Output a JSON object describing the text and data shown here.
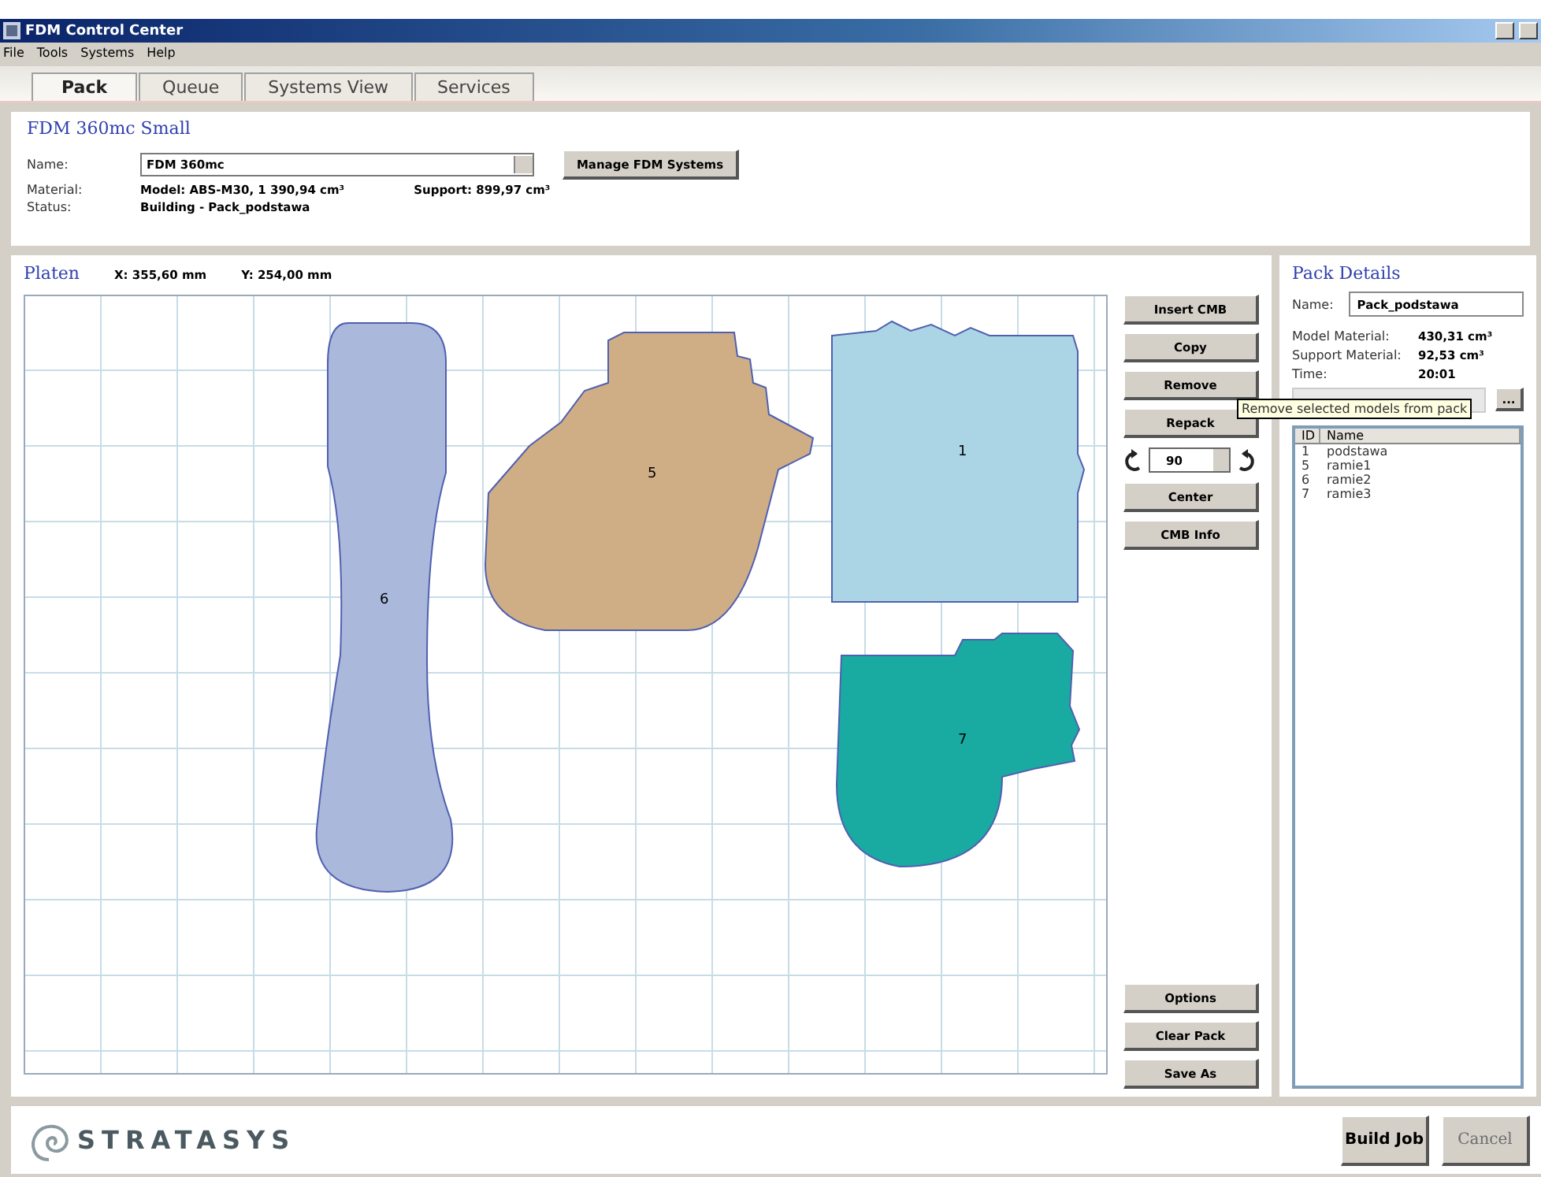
{
  "window": {
    "title": "FDM Control Center"
  },
  "menu": [
    "File",
    "Tools",
    "Systems",
    "Help"
  ],
  "tabs": [
    {
      "label": "Pack",
      "selected": true
    },
    {
      "label": "Queue",
      "selected": false
    },
    {
      "label": "Systems View",
      "selected": false
    },
    {
      "label": "Services",
      "selected": false
    }
  ],
  "system": {
    "title": "FDM 360mc Small",
    "name_label": "Name:",
    "name_value": "FDM 360mc",
    "manage_button": "Manage FDM Systems",
    "material_label": "Material:",
    "model_material": "Model: ABS-M30, 1 390,94 cm³",
    "support_material": "Support: 899,97 cm³",
    "status_label": "Status:",
    "status_value": "Building - Pack_podstawa"
  },
  "platen": {
    "title": "Platen",
    "x": "X: 355,60 mm",
    "y": "Y: 254,00 mm",
    "models": [
      {
        "label": "6",
        "color": "#aab8dc"
      },
      {
        "label": "5",
        "color": "#cfae86"
      },
      {
        "label": "1",
        "color": "#abd5e4"
      },
      {
        "label": "7",
        "color": "#19aba1"
      }
    ]
  },
  "actions": [
    "Insert CMB",
    "Copy",
    "Remove",
    "Repack"
  ],
  "rotation": {
    "value": "90"
  },
  "actions_2": [
    "Center",
    "CMB Info"
  ],
  "actions_bottom": [
    "Options",
    "Clear Pack",
    "Save As"
  ],
  "tooltip": "Remove selected models from pack",
  "pack_details": {
    "title": "Pack Details",
    "name_label": "Name:",
    "name_value": "Pack_podstawa",
    "stats": [
      {
        "label": "Model Material:",
        "value": "430,31 cm³"
      },
      {
        "label": "Support Material:",
        "value": "92,53 cm³"
      },
      {
        "label": "Time:",
        "value": "20:01"
      }
    ],
    "browse_button": "...",
    "columns": [
      "ID",
      "Name"
    ],
    "rows": [
      {
        "id": "1",
        "name": "podstawa"
      },
      {
        "id": "5",
        "name": "ramie1"
      },
      {
        "id": "6",
        "name": "ramie2"
      },
      {
        "id": "7",
        "name": "ramie3"
      }
    ]
  },
  "footer": {
    "logo": "STRATASYS",
    "build_button": "Build Job",
    "cancel_button": {
      "label": "Cancel",
      "disabled": true
    }
  }
}
